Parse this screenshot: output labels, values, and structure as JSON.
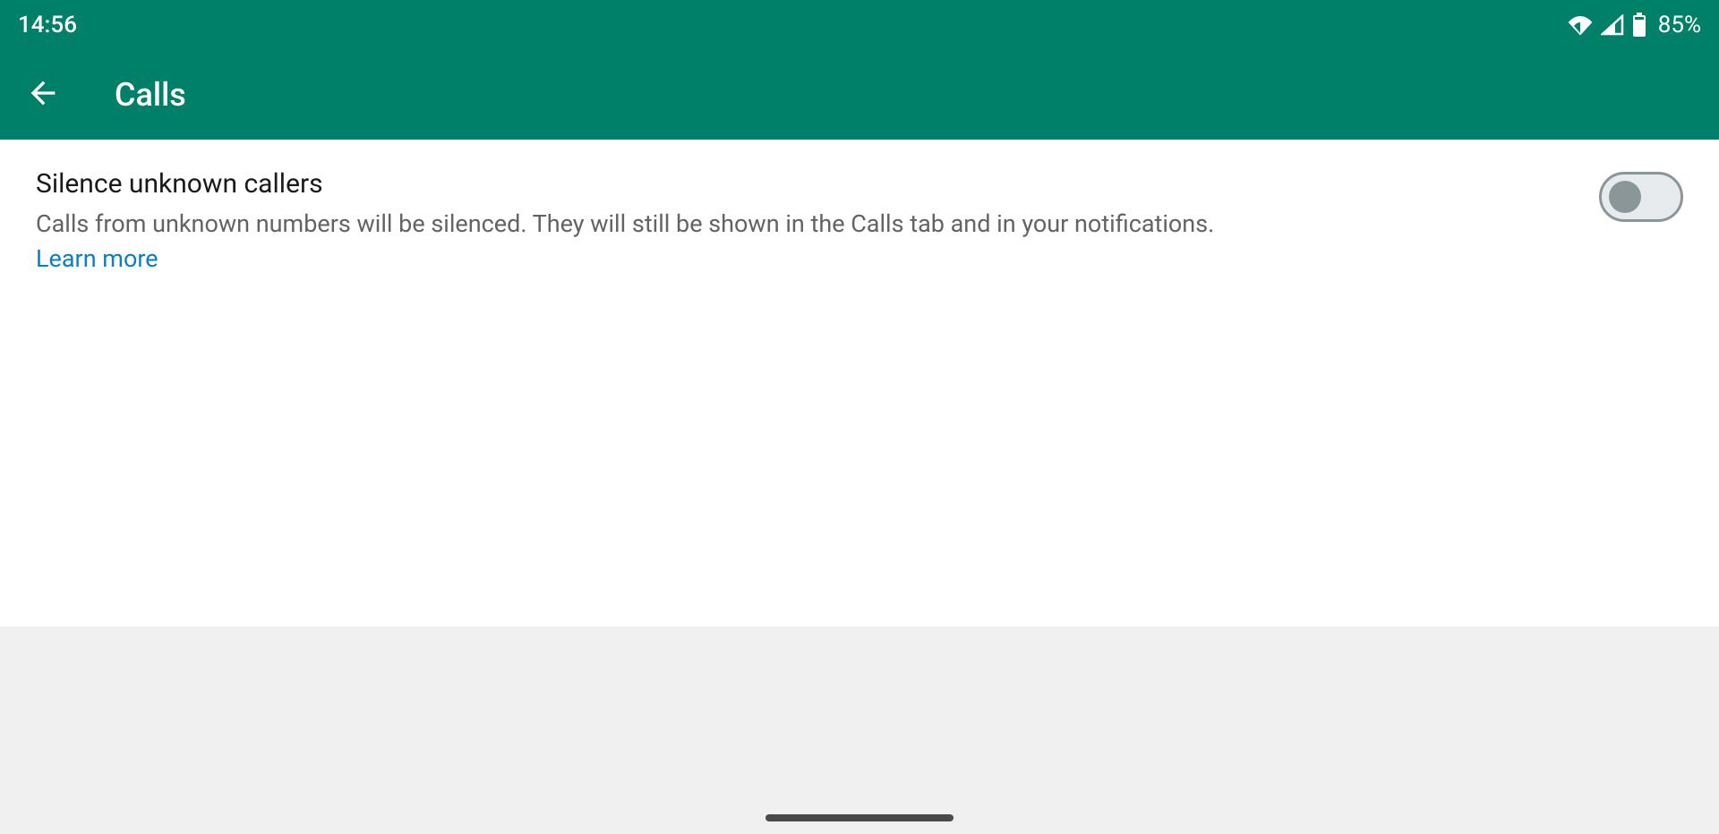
{
  "statusBar": {
    "time": "14:56",
    "battery": "85%"
  },
  "appBar": {
    "title": "Calls"
  },
  "setting": {
    "title": "Silence unknown callers",
    "description": "Calls from unknown numbers will be silenced. They will still be shown in the Calls tab and in your notifications.",
    "learnMore": "Learn more",
    "toggleState": "off"
  }
}
